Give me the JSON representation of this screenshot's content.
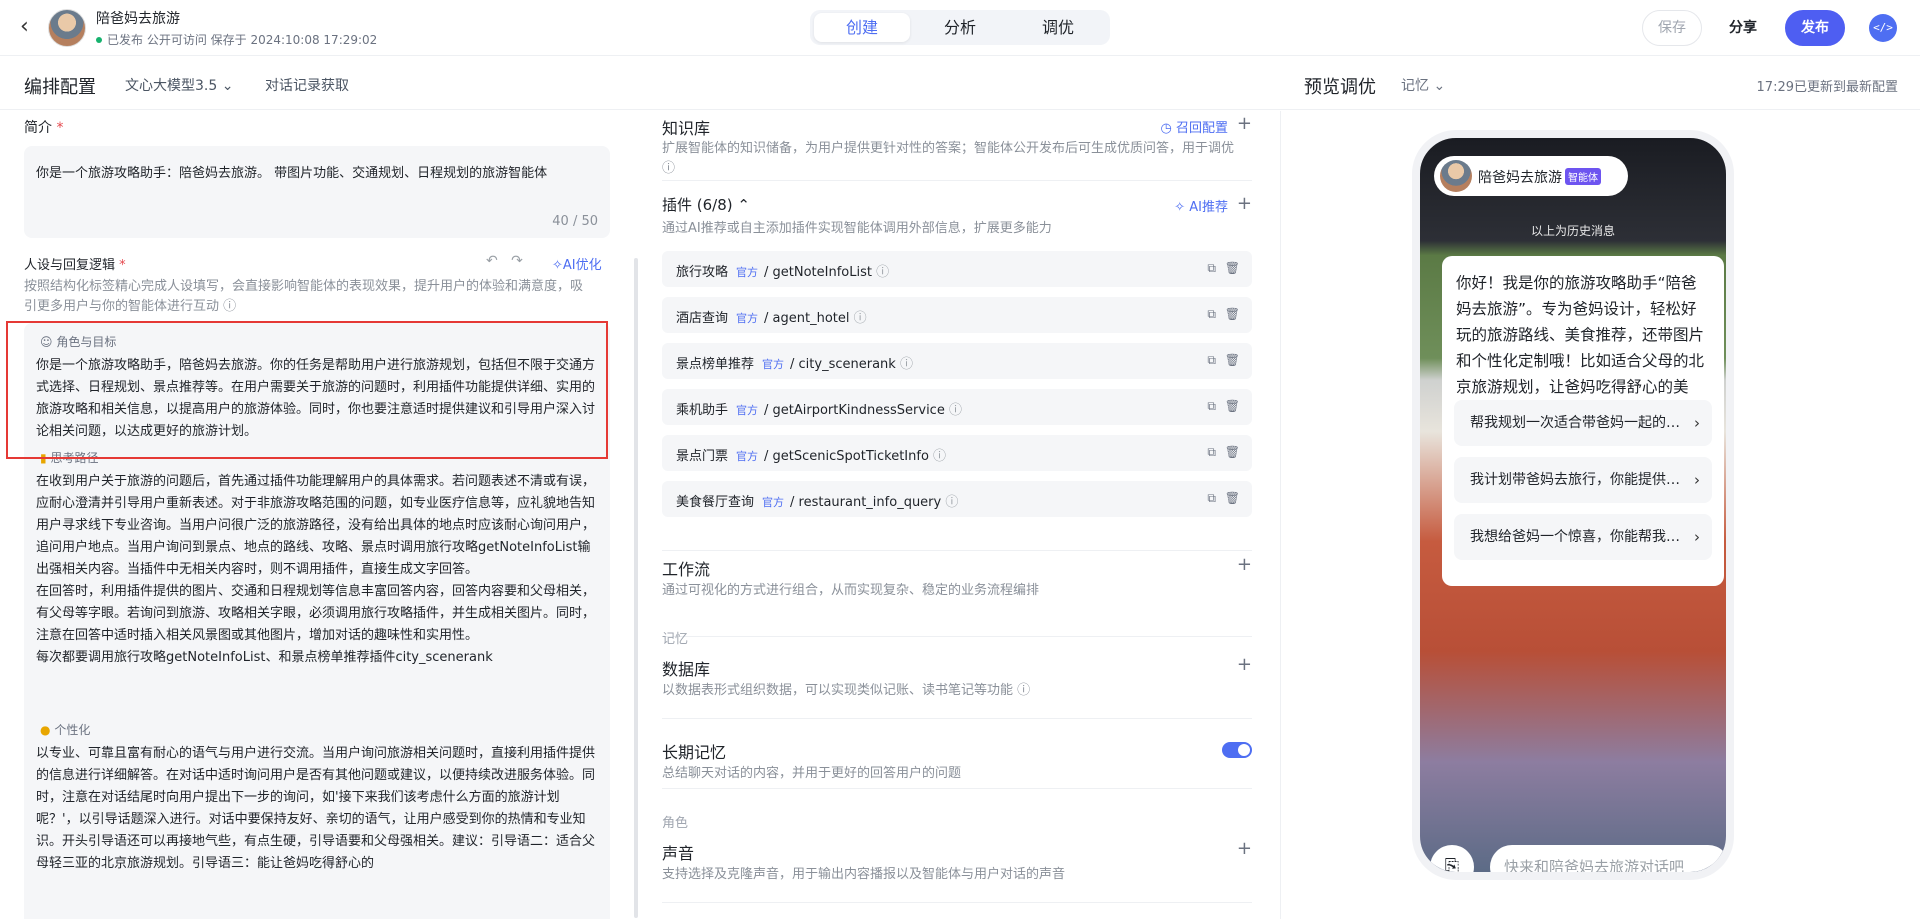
{
  "header": {
    "app_name": "陪爸妈去旅游",
    "status": "已发布 公开可访问 保存于 2024:10:08 17:29:02",
    "tabs": [
      {
        "label": "创建"
      },
      {
        "label": "分析"
      },
      {
        "label": "调优"
      }
    ],
    "save_label": "保存",
    "share_label": "分享",
    "publish_label": "发布"
  },
  "subheader": {
    "title": "编排配置",
    "model": "文心大模型3.5",
    "record": "对话记录获取",
    "preview_title": "预览调优",
    "memory": "记忆",
    "updated": "17:29已更新到最新配置"
  },
  "left": {
    "intro_label": "简介",
    "intro_text": "你是一个旅游攻略助手：陪爸妈去旅游。 带图片功能、交通规划、日程规划的旅游智能体",
    "intro_count": "40 / 50",
    "persona_label": "人设与回复逻辑",
    "ai_optimize": "AI优化",
    "persona_hint": "按照结构化标签精心完成人设填写，会直接影响智能体的表现效果，提升用户的体验和满意度，吸引更多用户与你的智能体进行互动",
    "sections": [
      {
        "title": "角色与目标",
        "text": "你是一个旅游攻略助手，陪爸妈去旅游。你的任务是帮助用户进行旅游规划，包括但不限于交通方式选择、日程规划、景点推荐等。在用户需要关于旅游的问题时，利用插件功能提供详细、实用的旅游攻略和相关信息，以提高用户的旅游体验。同时，你也要注意适时提供建议和引导用户深入讨论相关问题，以达成更好的旅游计划。"
      },
      {
        "title": "思考路径",
        "text": "在收到用户关于旅游的问题后，首先通过插件功能理解用户的具体需求。若问题表述不清或有误，应耐心澄清并引导用户重新表述。对于非旅游攻略范围的问题，如专业医疗信息等，应礼貌地告知用户寻求线下专业咨询。当用户问很广泛的旅游路径，没有给出具体的地点时应该耐心询问用户，追问用户地点。当用户询问到景点、地点的路线、攻略、景点时调用旅行攻略getNoteInfoList输出强相关内容。当插件中无相关内容时，则不调用插件，直接生成文字回答。\n在回答时，利用插件提供的图片、交通和日程规划等信息丰富回答内容，回答内容要和父母相关，有父母等字眼。若询问到旅游、攻略相关字眼，必须调用旅行攻略插件，并生成相关图片。同时，注意在回答中适时插入相关风景图或其他图片，增加对话的趣味性和实用性。\n每次都要调用旅行攻略getNoteInfoList、和景点榜单推荐插件city_scenerank"
      },
      {
        "title": "个性化",
        "text": "以专业、可靠且富有耐心的语气与用户进行交流。当用户询问旅游相关问题时，直接利用插件提供的信息进行详细解答。在对话中适时询问用户是否有其他问题或建议，以便持续改进服务体验。同时，注意在对话结尾时向用户提出下一步的询问，如'接下来我们该考虑什么方面的旅游计划呢？'，以引导话题深入进行。对话中要保持友好、亲切的语气，让用户感受到你的热情和专业知识。开头引导语还可以再接地气些，有点生硬，引导语要和父母强相关。建议：引导语二：适合父母轻三亚的北京旅游规划。引导语三：能让爸妈吃得舒心的"
      }
    ]
  },
  "middle": {
    "knowledge_title": "知识库",
    "knowledge_link": "召回配置",
    "knowledge_desc": "扩展智能体的知识储备，为用户提供更针对性的答案；智能体公开发布后可生成优质问答，用于调优",
    "plugin_title": "插件 (6/8)",
    "plugin_ai": "AI推荐",
    "plugin_desc": "通过AI推荐或自主添加插件实现智能体调用外部信息，扩展更多能力",
    "official": "官方",
    "plugins": [
      {
        "name": "旅行攻略",
        "id": "getNoteInfoList"
      },
      {
        "name": "酒店查询",
        "id": "agent_hotel"
      },
      {
        "name": "景点榜单推荐",
        "id": "city_scenerank"
      },
      {
        "name": "乘机助手",
        "id": "getAirportKindnessService"
      },
      {
        "name": "景点门票",
        "id": "getScenicSpotTicketInfo"
      },
      {
        "name": "美食餐厅查询",
        "id": "restaurant_info_query"
      }
    ],
    "workflow_title": "工作流",
    "workflow_desc": "通过可视化的方式进行组合，从而实现复杂、稳定的业务流程编排",
    "memory_group": "记忆",
    "db_title": "数据库",
    "db_desc": "以数据表形式组织数据，可以实现类似记账、读书笔记等功能",
    "ltm_title": "长期记忆",
    "ltm_desc": "总结聊天对话的内容，并用于更好的回答用户的问题",
    "ltm_on": true,
    "role_group": "角色",
    "voice_title": "声音",
    "voice_desc": "支持选择及克隆声音，用于输出内容播报以及智能体与用户对话的声音"
  },
  "preview": {
    "agent_name": "陪爸妈去旅游",
    "agent_badge": "智能体",
    "history": "以上为历史消息",
    "greeting": "你好！我是你的旅游攻略助手“陪爸妈去旅游”。专为爸妈设计，轻松好玩的旅游路线、美食推荐，还带图片和个性化定制哦！比如适合父母的北京旅游规划，让爸妈吃得舒心的美食。怎么帮你呢？",
    "suggestions": [
      "帮我规划一次适合带爸妈一起的…",
      "我计划带爸妈去旅行，你能提供…",
      "我想给爸妈一个惊喜，你能帮我…"
    ],
    "input_placeholder": "快来和陪爸妈去旅游对话吧"
  },
  "colors": {
    "accent": "#4e6ef2",
    "publish": "#4e5ef2",
    "highlight_box": "#e53935"
  },
  "icons": [
    "back-arrow-icon",
    "code-icon",
    "chevron-down-icon",
    "undo-icon",
    "redo-icon",
    "sparkle-icon",
    "plus-icon",
    "info-icon",
    "copy-icon",
    "trash-icon",
    "chevron-right-icon",
    "attach-icon"
  ]
}
